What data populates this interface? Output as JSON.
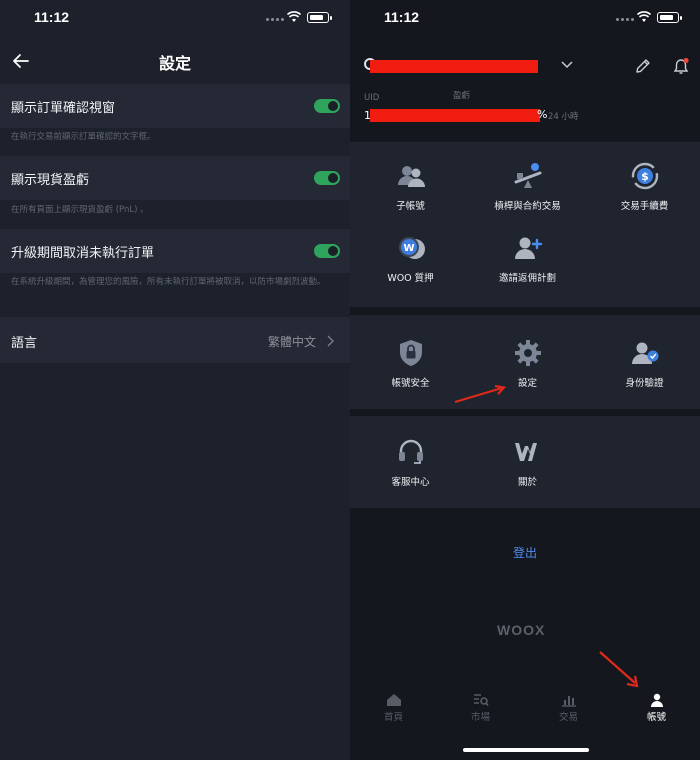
{
  "left": {
    "status": {
      "time": "11:12"
    },
    "title": "設定",
    "settings": [
      {
        "label": "顯示訂單確認視窗",
        "desc": "在執行交易前顯示訂單確認的文字框。",
        "enabled": true
      },
      {
        "label": "顯示現貨盈虧",
        "desc": "在所有頁面上顯示現貨盈虧 (PnL) 。",
        "enabled": true
      },
      {
        "label": "升級期間取消未執行訂單",
        "desc": "在系統升級期間，為管理您的風險，所有未執行訂單將被取消，以防市場劇烈波動。",
        "enabled": true
      }
    ],
    "language": {
      "label": "語言",
      "value": "繁體中文"
    }
  },
  "right": {
    "status": {
      "time": "11:12"
    },
    "profile": {
      "uid_label": "UID",
      "pnl_label": "盈虧",
      "uid_value": "1",
      "pnl_suffix": "%",
      "pnl_period": "24 小時"
    },
    "grid1": [
      {
        "label": "子帳號",
        "icon": "sub-account-icon"
      },
      {
        "label": "槓桿與合約交易",
        "icon": "leverage-icon"
      },
      {
        "label": "交易手續費",
        "icon": "trading-fee-icon"
      },
      {
        "label": "WOO 質押",
        "icon": "woo-staking-icon"
      },
      {
        "label": "邀請返佣計劃",
        "icon": "referral-icon"
      }
    ],
    "grid2": [
      {
        "label": "帳號安全",
        "icon": "shield-lock-icon"
      },
      {
        "label": "設定",
        "icon": "gear-icon"
      },
      {
        "label": "身份驗證",
        "icon": "identity-verified-icon"
      }
    ],
    "grid3": [
      {
        "label": "客服中心",
        "icon": "headset-icon"
      },
      {
        "label": "關於",
        "icon": "woo-logo-icon"
      }
    ],
    "logout": "登出",
    "brand": "WOOX",
    "tabs": [
      {
        "label": "首頁",
        "icon": "home-icon",
        "active": false
      },
      {
        "label": "市場",
        "icon": "market-icon",
        "active": false
      },
      {
        "label": "交易",
        "icon": "trade-icon",
        "active": false
      },
      {
        "label": "帳號",
        "icon": "account-icon",
        "active": true
      }
    ],
    "colors": {
      "accent_green": "#2fa45d",
      "link_blue": "#4f8df0",
      "annotation_red": "#e0281b"
    }
  }
}
